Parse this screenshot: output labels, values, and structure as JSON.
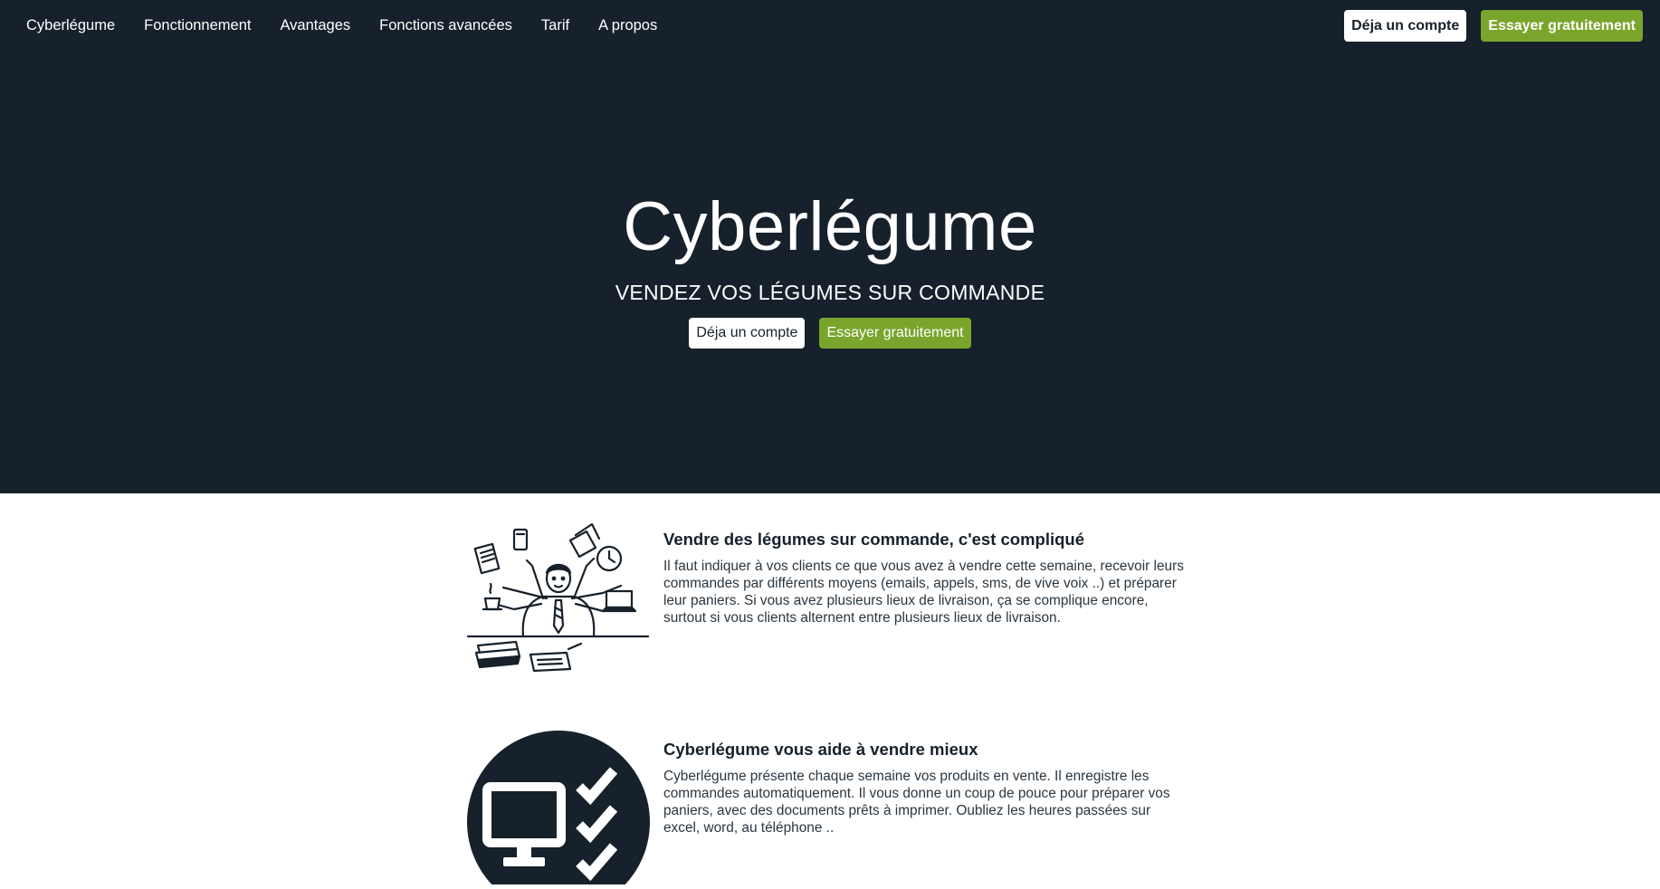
{
  "nav": {
    "links": [
      "Cyberlégume",
      "Fonctionnement",
      "Avantages",
      "Fonctions avancées",
      "Tarif",
      "A propos"
    ],
    "login_label": "Déja un compte",
    "trial_label": "Essayer gratuitement"
  },
  "hero": {
    "title": "Cyberlégume",
    "subtitle": "VENDEZ VOS LÉGUMES SUR COMMANDE",
    "login_label": "Déja un compte",
    "trial_label": "Essayer gratuitement"
  },
  "features": [
    {
      "icon": "busy-multitasking-man-icon",
      "title": "Vendre des légumes sur commande, c'est compliqué",
      "lines": [
        "Il faut indiquer à vos clients ce que vous avez à vendre cette semaine, recevoir leurs",
        "commandes par différents moyens (emails, appels, sms, de vive voix ..) et préparer",
        "leur paniers. Si vous avez plusieurs lieux de livraison, ça se complique encore,",
        "surtout si vous clients alternent entre plusieurs lieux de livraison."
      ]
    },
    {
      "icon": "computer-checklist-icon",
      "title": "Cyberlégume vous aide à vendre mieux",
      "lines": [
        "Cyberlégume présente chaque semaine vos produits en vente. Il enregistre les",
        "commandes automatiquement. Il vous donne un coup de pouce pour préparer vos",
        "paniers, avec des documents prêts à imprimer. Oubliez les heures passées sur",
        "excel, word, au téléphone .."
      ]
    }
  ],
  "colors": {
    "dark": "#16212b",
    "accent_green": "#7aa52c",
    "white": "#ffffff"
  }
}
